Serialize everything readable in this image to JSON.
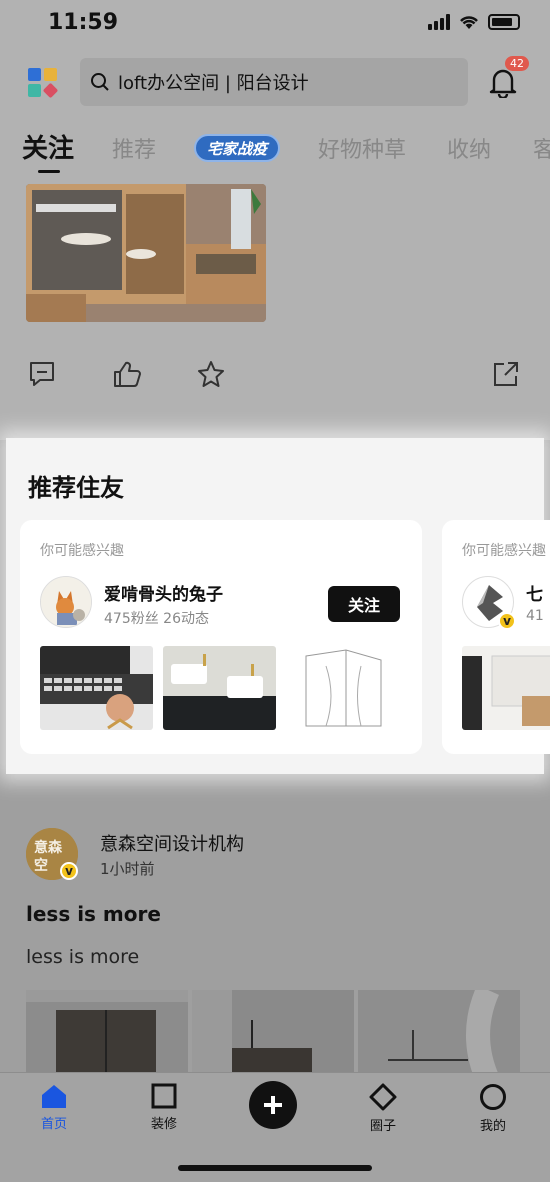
{
  "status_bar": {
    "time": "11:59"
  },
  "header": {
    "search_placeholder": "loft办公空间 | 阳台设计",
    "notification_count": "42"
  },
  "tabs": [
    {
      "label": "关注",
      "active": true
    },
    {
      "label": "推荐"
    },
    {
      "label": "宅家战疫",
      "special": true
    },
    {
      "label": "好物种草"
    },
    {
      "label": "收纳"
    },
    {
      "label": "客"
    }
  ],
  "recommend": {
    "title": "推荐住友",
    "cards": [
      {
        "hint": "你可能感兴趣",
        "name": "爱啃骨头的兔子",
        "stats": "475粉丝 26动态",
        "follow_label": "关注"
      },
      {
        "hint": "你可能感兴趣",
        "name": "七",
        "stats": "41"
      }
    ]
  },
  "post": {
    "author": "意森空间设计机构",
    "time": "1小时前",
    "title": "less is more",
    "body": "less is more",
    "avatar_text": "意森空",
    "verified_mark": "v"
  },
  "tabbar": {
    "items": [
      {
        "label": "首页",
        "icon": "home-icon",
        "active": true
      },
      {
        "label": "装修",
        "icon": "square-icon"
      },
      {
        "label": "",
        "icon": "plus-icon"
      },
      {
        "label": "圈子",
        "icon": "diamond-icon"
      },
      {
        "label": "我的",
        "icon": "circle-icon"
      }
    ]
  },
  "colors": {
    "accent_blue": "#1a56e0",
    "badge_red": "#e0594d",
    "follow_button": "#111111",
    "verified_yellow": "#f2c21b"
  }
}
